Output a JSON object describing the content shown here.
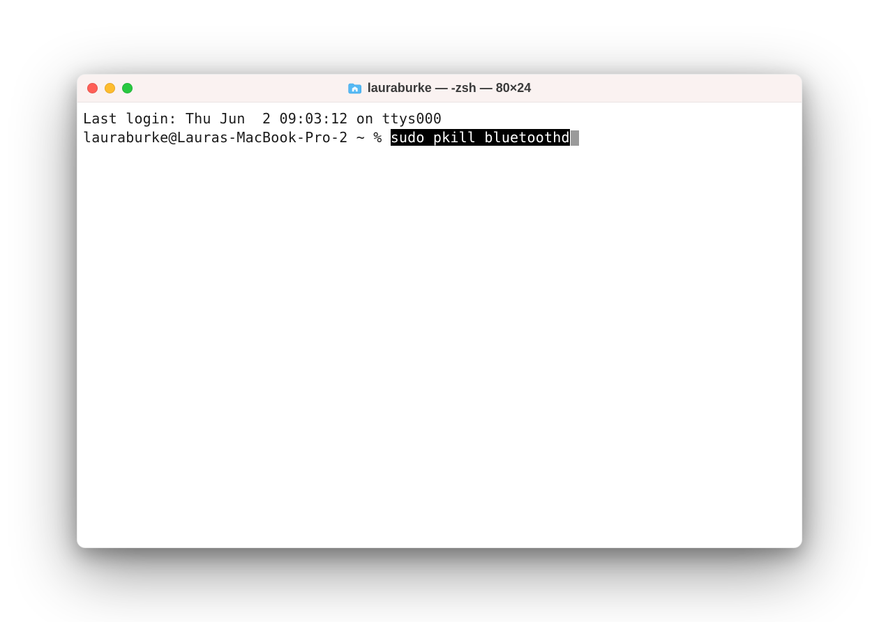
{
  "window": {
    "title": "lauraburke — -zsh — 80×24",
    "icon_name": "home-folder-icon"
  },
  "traffic_lights": {
    "close": "close",
    "minimize": "minimize",
    "zoom": "zoom"
  },
  "terminal": {
    "last_login": "Last login: Thu Jun  2 09:03:12 on ttys000",
    "prompt": "lauraburke@Lauras-MacBook-Pro-2 ~ % ",
    "selected_command": "sudo pkill bluetoothd"
  },
  "colors": {
    "titlebar_bg": "#faf2f1",
    "close": "#ff5f57",
    "min": "#febc2e",
    "zoom": "#28c840",
    "selection_bg": "#000000",
    "selection_fg": "#ffffff"
  }
}
